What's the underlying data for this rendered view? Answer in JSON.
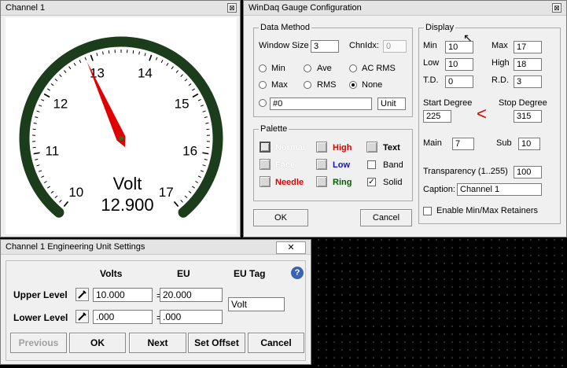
{
  "channel_window": {
    "title": "Channel 1",
    "close_glyph": "⊠",
    "gauge": {
      "tick_labels": [
        "10",
        "11",
        "12",
        "13",
        "14",
        "15",
        "16",
        "17"
      ],
      "unit": "Volt",
      "reading": "12.900",
      "min": 10,
      "max": 17,
      "value": 12.9,
      "start_degree": 225,
      "stop_degree": 315,
      "arc_color": "#3d6e3d",
      "needle_color": "#e00000"
    }
  },
  "config": {
    "title": "WinDaq Gauge Configuration",
    "close_glyph": "⊠",
    "data_method": {
      "title": "Data Method",
      "window_size_label": "Window Size",
      "window_size": "3",
      "chnldx_label": "ChnIdx:",
      "chnldx": "0",
      "min_label": "Min",
      "ave_label": "Ave",
      "acrms_label": "AC RMS",
      "max_label": "Max",
      "rms_label": "RMS",
      "none_label": "None",
      "expr": "#0",
      "unit": "Unit"
    },
    "palette": {
      "title": "Palette",
      "normal": "Normal",
      "high": "High",
      "text": "Text",
      "face": "Face",
      "low": "Low",
      "band": "Band",
      "needle": "Needle",
      "ring": "Ring",
      "solid": "Solid",
      "high_color": "#e00000",
      "low_color": "#1010d0",
      "needle_color": "#e00000",
      "ring_color": "#006000"
    },
    "display": {
      "title": "Display",
      "min_label": "Min",
      "min": "10",
      "max_label": "Max",
      "max": "17",
      "low_label": "Low",
      "low": "10",
      "high_label": "High",
      "high": "18",
      "td_label": "T.D.",
      "td": "0",
      "rd_label": "R.D.",
      "rd": "3",
      "start_label": "Start Degree",
      "start": "225",
      "stop_label": "Stop Degree",
      "stop": "315",
      "arrow": "<",
      "main_label": "Main",
      "main": "7",
      "sub_label": "Sub",
      "sub": "10",
      "transparency_label": "Transparency (1..255)",
      "transparency": "100",
      "caption_label": "Caption:",
      "caption": "Channel 1",
      "retainers_label": "Enable Min/Max Retainers"
    },
    "ok": "OK",
    "cancel": "Cancel"
  },
  "eu": {
    "title": "Channel 1 Engineering Unit Settings",
    "close_glyph": "✕",
    "col_volts": "Volts",
    "col_eu": "EU",
    "col_tag": "EU Tag",
    "upper_label": "Upper Level",
    "upper_volts": "10.000",
    "upper_eu": "20.000",
    "lower_label": "Lower Level",
    "lower_volts": ".000",
    "lower_eu": ".000",
    "eq": "=",
    "tag": "Volt",
    "help": "?",
    "previous": "Previous",
    "ok": "OK",
    "next": "Next",
    "set_offset": "Set Offset",
    "cancel": "Cancel"
  }
}
